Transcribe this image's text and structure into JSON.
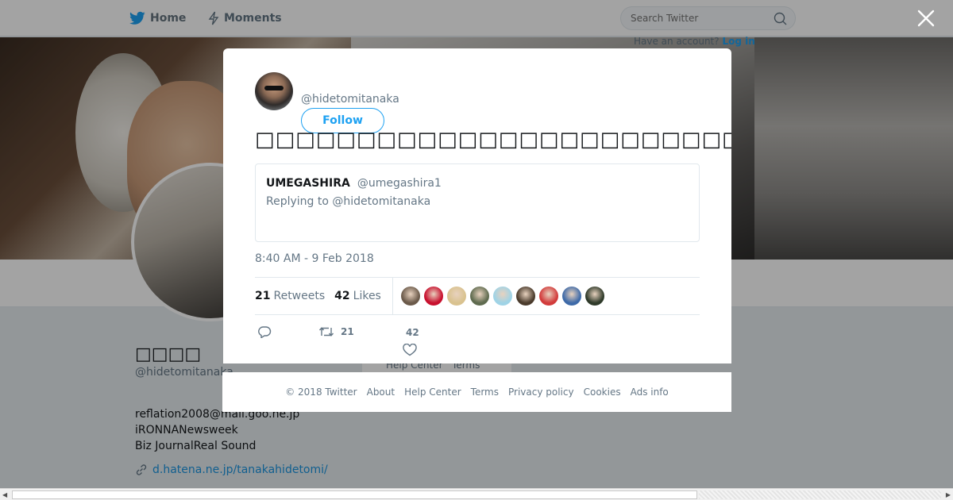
{
  "nav": {
    "home_label": "Home",
    "moments_label": "Moments",
    "search_placeholder": "Search Twitter",
    "have_account_text": "Have an account?",
    "login_label": "Log in"
  },
  "profile": {
    "name": "□□□□",
    "handle": "@hidetomitanaka",
    "bio_lines": [
      "reflation2008@mail.goo.ne.jp",
      "iRONNANewsweek",
      "Biz JournalReal Sound"
    ],
    "link": "d.hatena.ne.jp/tanakahidetomi/",
    "help_center": "Help Center",
    "terms": "Terms"
  },
  "modal": {
    "author_handle": "@hidetomitanaka",
    "follow_label": "Follow",
    "tweet_text": "□□□□□□□□□□□□□□□□□□□□□□□□□□□□□□□□□□□□□□□□□□□□□□□□□□□□□□□□□□□□□□",
    "quoted": {
      "name": "UMEGASHIRA",
      "handle": "@umegashira1",
      "reply_text": "Replying to @hidetomitanaka"
    },
    "timestamp": "8:40 AM - 9 Feb 2018",
    "retweets_count": "21",
    "retweets_label": "Retweets",
    "likes_count": "42",
    "likes_label": "Likes",
    "liker_avatar_colors": [
      "#6b5a4a",
      "#c8102e",
      "#d9c28f",
      "#5f6b4f",
      "#9fd3e6",
      "#4a3b2c",
      "#d23b3b",
      "#3e6aa8",
      "#2f3a2a"
    ],
    "action_retweet_count": "21",
    "action_like_count": "42"
  },
  "footer": {
    "links": [
      "© 2018 Twitter",
      "About",
      "Help Center",
      "Terms",
      "Privacy policy",
      "Cookies",
      "Ads info"
    ]
  },
  "colors": {
    "accent": "#1da1f2",
    "muted_text": "#657786"
  }
}
